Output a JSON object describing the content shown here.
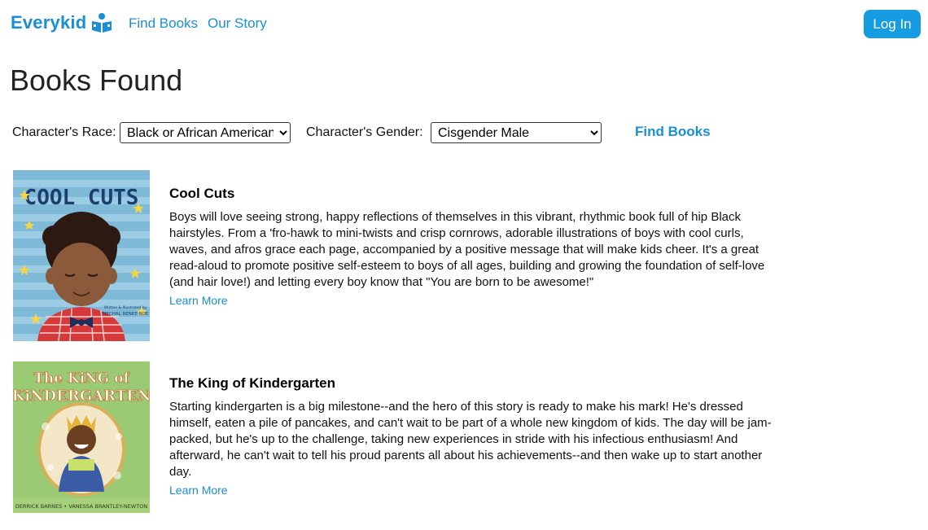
{
  "header": {
    "brand": "Everykid",
    "nav": [
      {
        "label": "Find Books"
      },
      {
        "label": "Our Story"
      }
    ],
    "login_label": "Log In"
  },
  "page_title": "Books Found",
  "filters": {
    "race_label": "Character's Race:",
    "race_value": "Black or African American",
    "gender_label": "Character's Gender:",
    "gender_value": "Cisgender Male",
    "submit_label": "Find Books"
  },
  "books": [
    {
      "title": "Cool Cuts",
      "description": "Boys will love seeing strong, happy reflections of themselves in this vibrant, rhythmic book full of hip Black hairstyles. From a 'fro-hawk to mini-twists and crisp cornrows, adorable illustrations of boys with cool curls, waves, and afros grace each page, accompanied by a positive message that will make kids cheer. It's a great read-aloud to promote positive self-esteem to boys of all ages, building and growing the foundation of self-love (and hair love!) and letting every boy know that \"You are born to be awesome!\"",
      "link_label": "Learn More",
      "cover": {
        "title_text": "COOL CUTS",
        "author_text": "MECHAL RENEE ROE",
        "byline_text": "Written & Illustrated by"
      }
    },
    {
      "title": "The King of Kindergarten",
      "description": "Starting kindergarten is a big milestone--and the hero of this story is ready to make his mark! He's dressed himself, eaten a pile of pancakes, and can't wait to be part of a whole new kingdom of kids. The day will be jam-packed, but he's up to the challenge, taking new experiences in stride with his infectious enthusiasm! And afterward, he can't wait to tell his proud parents all about his achievements--and then wake up to start another day.",
      "link_label": "Learn More",
      "cover": {
        "title_line1": "The KiNG of",
        "title_line2": "KiNDERGARTEN",
        "author_text": "DERRICK BARNES • VANESSA BRANTLEY-NEWTON"
      }
    }
  ]
}
